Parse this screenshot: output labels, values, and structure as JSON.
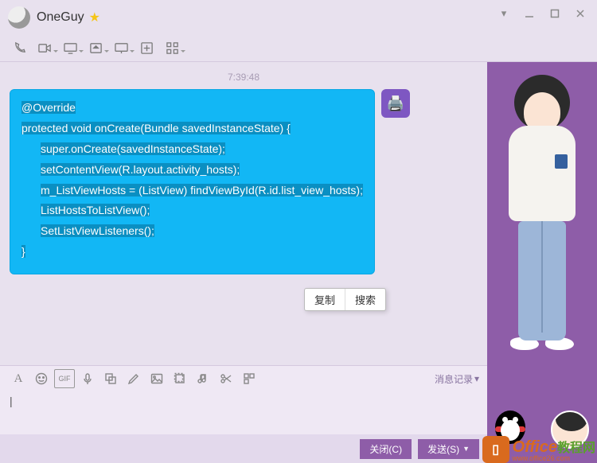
{
  "header": {
    "contact_name": "OneGuy"
  },
  "window_controls": {
    "dropdown": "▾",
    "minimize": "—",
    "maximize": "□",
    "close": "✕"
  },
  "chat": {
    "timestamp": "7:39:48",
    "code_lines": [
      "@Override",
      "protected void onCreate(Bundle savedInstanceState) {",
      "super.onCreate(savedInstanceState);",
      "setContentView(R.layout.activity_hosts);",
      "",
      "m_ListViewHosts = (ListView) findViewById(R.id.list_view_hosts);",
      "",
      "ListHostsToListView();",
      "SetListViewListeners();",
      "}"
    ]
  },
  "context_menu": {
    "copy": "复制",
    "search": "搜索"
  },
  "compose": {
    "history_label": "消息记录"
  },
  "footer": {
    "close_btn": "关闭(C)",
    "send_btn": "发送(S)"
  },
  "watermark": {
    "brand1": "Office",
    "brand2": "教程网",
    "url": "www.office26.com"
  }
}
